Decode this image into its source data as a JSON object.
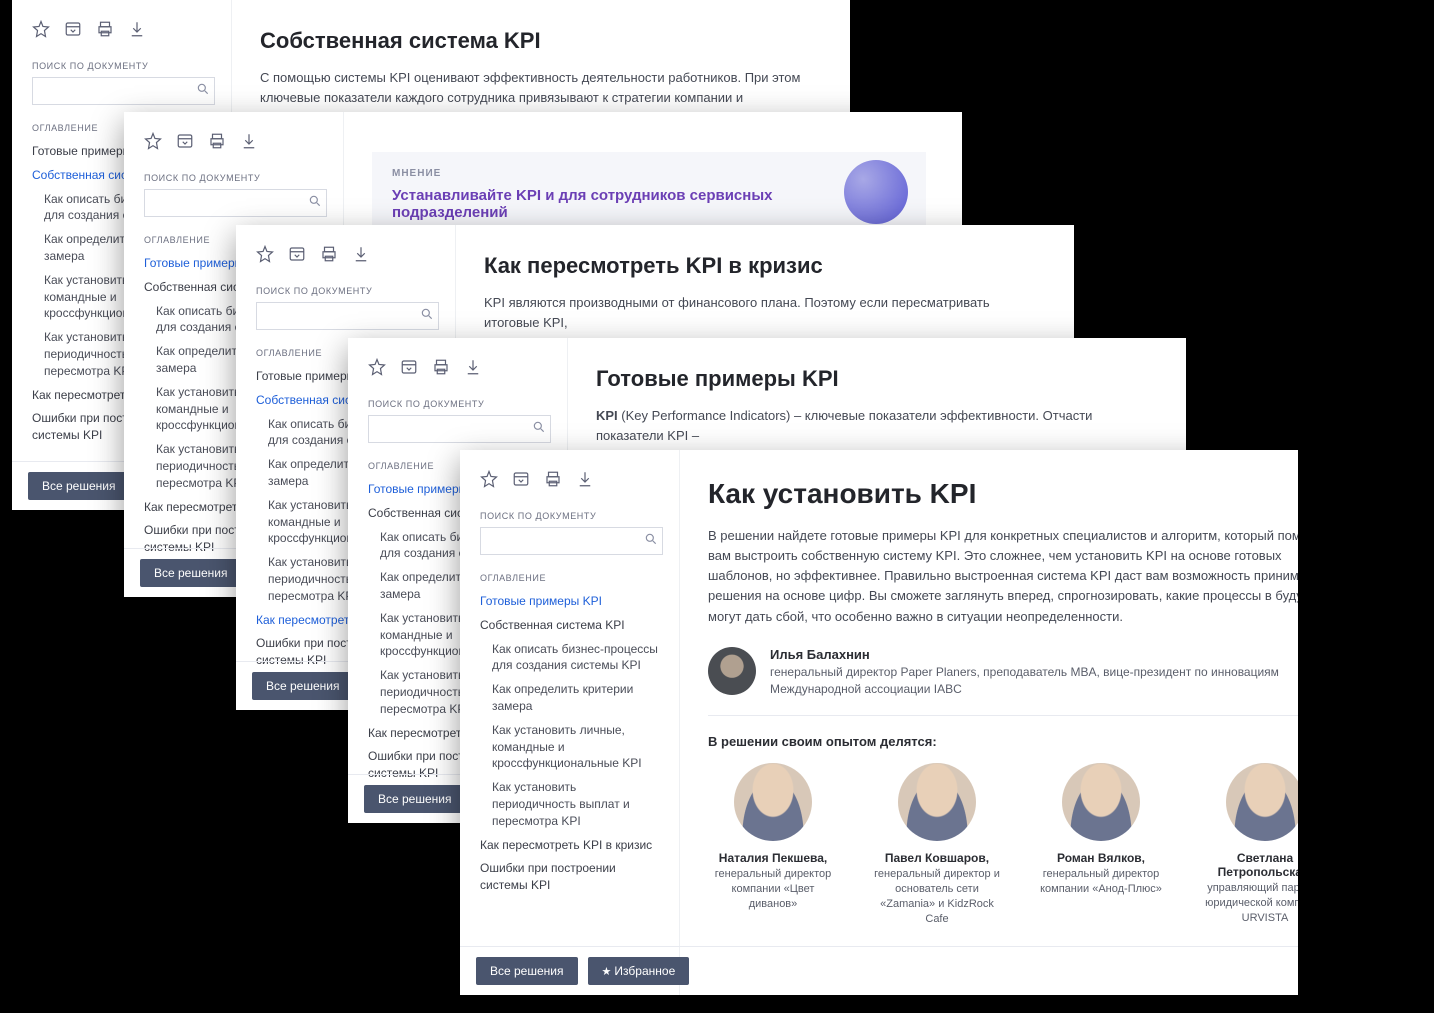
{
  "common": {
    "search_label": "ПОИСК ПО ДОКУМЕНТУ",
    "toc_label": "ОГЛАВЛЕНИЕ",
    "all_solutions": "Все решения",
    "favorites": "Избранное"
  },
  "toc": {
    "items": [
      "Готовые примеры KPI",
      "Собственная система KPI",
      "Как описать бизнес-процессы для создания системы KPI",
      "Как определить критерии замера",
      "Как установить личные, командные и кроссфункциональные KPI",
      "Как установить периодичность выплат и пересмотра KPI",
      "Как пересмотреть KPI в кризис",
      "Ошибки при построении системы KPI"
    ]
  },
  "card1": {
    "title": "Собственная система KPI",
    "body": "С помощью системы KPI оценивают эффективность деятельности работников. При этом ключевые показатели каждого сотрудника привязывают к стратегии компании и индикаторам"
  },
  "card2": {
    "opinion_label": "МНЕНИЕ",
    "opinion_title": "Устанавливайте KPI и для сотрудников сервисных подразделений"
  },
  "card3": {
    "title": "Как пересмотреть KPI в кризис",
    "body": "KPI являются производными от финансового плана. Поэтому если пересматривать итоговые KPI,"
  },
  "card4": {
    "title": "Готовые примеры KPI",
    "body_prefix": "KPI",
    "body": " (Key Performance Indicators) – ключевые показатели эффективности. Отчасти показатели KPI –"
  },
  "card5": {
    "title": "Как установить KPI",
    "body": "В решении найдете готовые примеры KPI для конкретных специалистов и алгоритм, который поможет вам выстроить собственную систему KPI. Это сложнее, чем установить KPI на основе готовых шаблонов, но эффективнее. Правильно выстроенная система KPI даст вам возможность принимать решения на основе цифр. Вы сможете заглянуть вперед, спрогнозировать, какие процессы в будущем могут дать сбой, что особенно важно в ситуации неопределенности.",
    "author": {
      "name": "Илья Балахнин",
      "role": "генеральный директор Paper Planers, преподаватель MBA, вице-президент по инновациям Международной ассоциации IABC"
    },
    "contrib_label": "В решении своим опытом делятся:",
    "contributors": [
      {
        "name": "Наталия Пекшева,",
        "role": "генеральный директор компании «Цвет диванов»"
      },
      {
        "name": "Павел Ковшаров,",
        "role": "генеральный директор и основатель сети «Zamania» и KidzRock Cafe"
      },
      {
        "name": "Роман Вялков,",
        "role": "генеральный директор компании «Анод-Плюс»"
      },
      {
        "name": "Светлана Петропольская,",
        "role": "управляющий партнер юридической компании URVISTA"
      }
    ]
  }
}
